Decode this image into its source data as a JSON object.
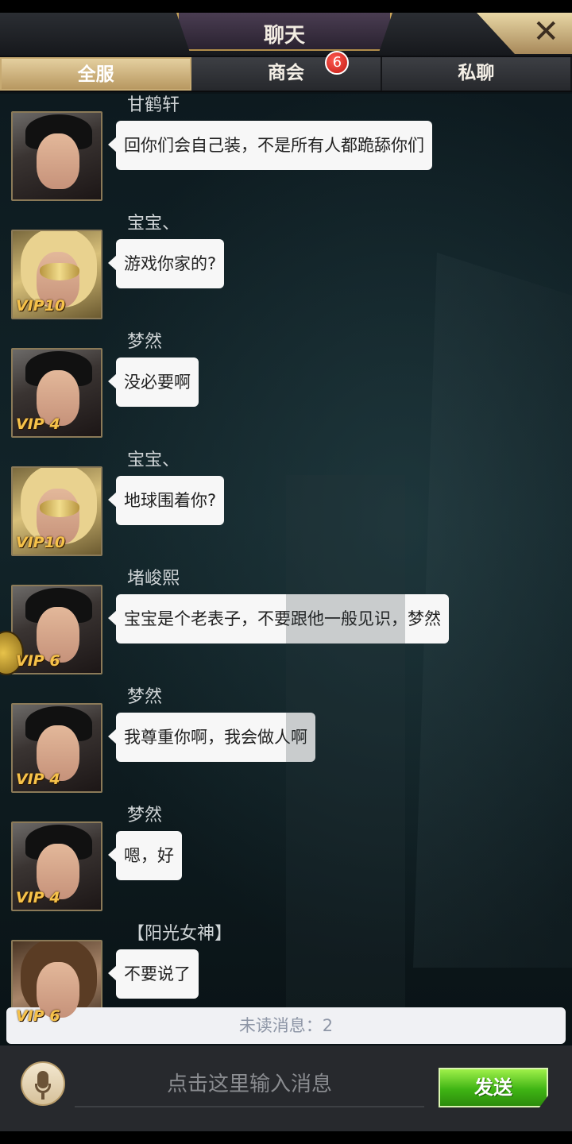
{
  "header": {
    "title": "聊天",
    "close_label": "✕"
  },
  "tabs": [
    {
      "label": "全服",
      "active": true
    },
    {
      "label": "商会",
      "badge": "6"
    },
    {
      "label": "私聊"
    }
  ],
  "messages": [
    {
      "name": "甘鹤轩",
      "text": "回你们会自己装，不是所有人都跪舔你们",
      "vip": "",
      "avatar": "male"
    },
    {
      "name": "宝宝、",
      "text": "游戏你家的?",
      "vip": "VIP10",
      "avatar": "female-blonde"
    },
    {
      "name": "梦然",
      "text": "没必要啊",
      "vip": "VIP 4",
      "avatar": "male"
    },
    {
      "name": "宝宝、",
      "text": "地球围着你?",
      "vip": "VIP10",
      "avatar": "female-blonde"
    },
    {
      "name": "堵峻熙",
      "text": "宝宝是个老表子，不要跟他一般见识，梦然",
      "vip": "VIP 6",
      "avatar": "male"
    },
    {
      "name": "梦然",
      "text": "我尊重你啊，我会做人啊",
      "vip": "VIP 4",
      "avatar": "male"
    },
    {
      "name": "梦然",
      "text": "嗯，好",
      "vip": "VIP 4",
      "avatar": "male"
    },
    {
      "name": "【阳光女神】",
      "text": "不要说了",
      "vip": "VIP 6",
      "avatar": "female-brown"
    }
  ],
  "unread": {
    "text": "未读消息：2"
  },
  "input": {
    "placeholder": "点击这里输入消息",
    "send_label": "发送"
  },
  "colors": {
    "send_green": "#3fb414",
    "tab_gold": "#c7aa72",
    "badge_red": "#c11a14"
  }
}
